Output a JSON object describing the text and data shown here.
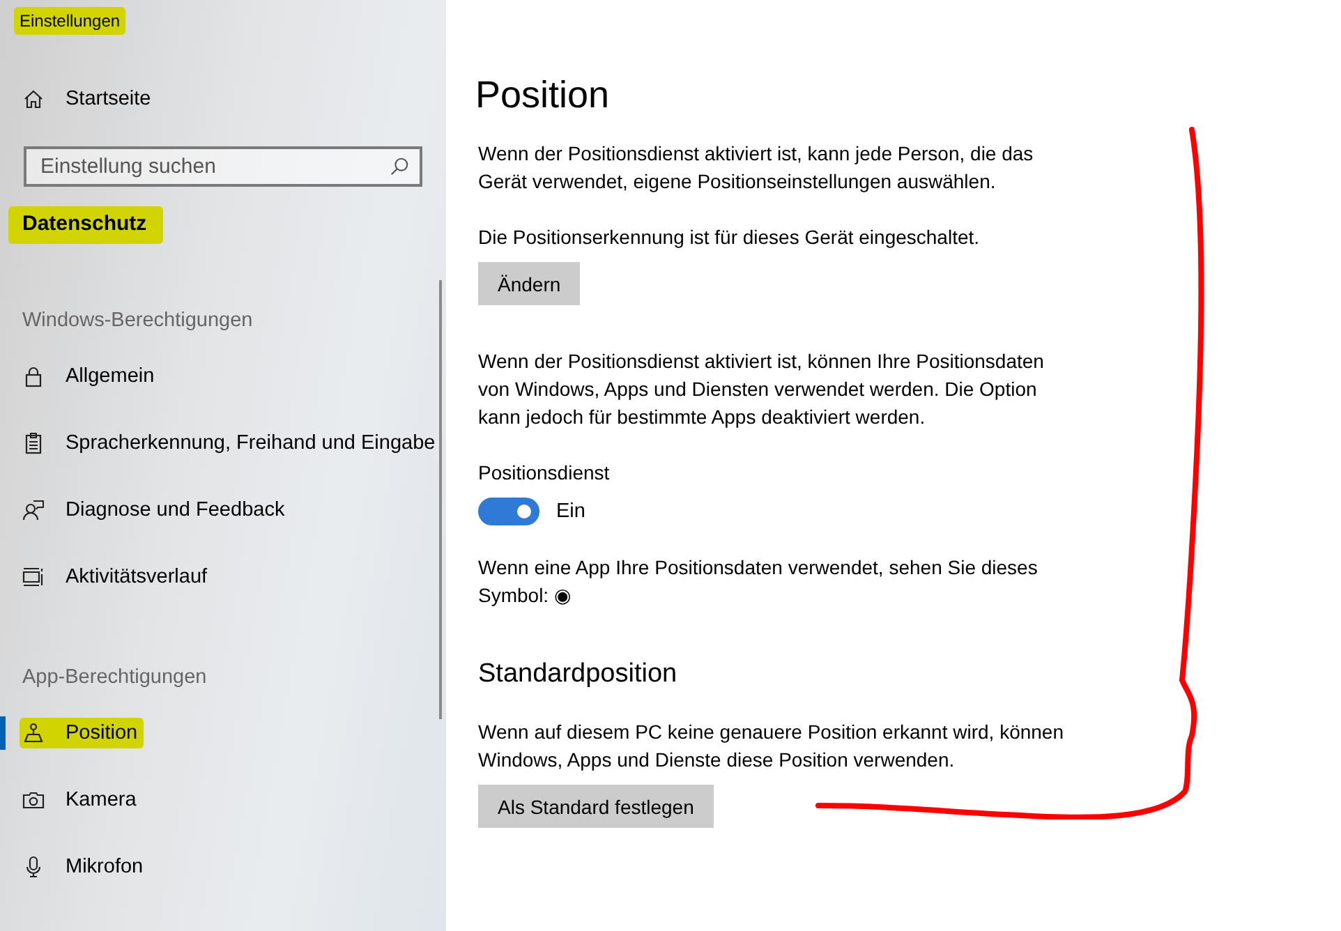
{
  "window": {
    "title": "Einstellungen",
    "highlighted": true
  },
  "sidebar": {
    "home": {
      "label": "Startseite"
    },
    "search": {
      "placeholder": "Einstellung suchen"
    },
    "category": {
      "label": "Datenschutz",
      "highlighted": true
    },
    "groups": [
      {
        "heading": "Windows-Berechtigungen",
        "items": [
          {
            "label": "Allgemein",
            "selected": false,
            "highlighted": false
          },
          {
            "label": "Spracherkennung, Freihand und Eingabe",
            "selected": false,
            "highlighted": false
          },
          {
            "label": "Diagnose und Feedback",
            "selected": false,
            "highlighted": false
          },
          {
            "label": "Aktivitätsverlauf",
            "selected": false,
            "highlighted": false
          }
        ]
      },
      {
        "heading": "App-Berechtigungen",
        "items": [
          {
            "label": "Position",
            "selected": true,
            "highlighted": true
          },
          {
            "label": "Kamera",
            "selected": false,
            "highlighted": false
          },
          {
            "label": "Mikrofon",
            "selected": false,
            "highlighted": false
          }
        ]
      }
    ]
  },
  "content": {
    "title": "Position",
    "blocks": [
      {
        "kind": "paragraph",
        "text": "Wenn der Positionsdienst aktiviert ist, kann jede Person, die das Gerät verwendet, eigene Positionseinstellungen auswählen."
      },
      {
        "kind": "paragraph",
        "text": "Die Positionserkennung ist für dieses Gerät eingeschaltet."
      },
      {
        "kind": "button",
        "text": "Ändern"
      },
      {
        "kind": "paragraph",
        "text": "Wenn der Positionsdienst aktiviert ist, können Ihre Positionsdaten von Windows, Apps und Diensten verwendet werden. Die Option kann jedoch für bestimmte Apps deaktiviert werden."
      },
      {
        "kind": "label",
        "text": "Positionsdienst"
      },
      {
        "kind": "toggle",
        "on": true,
        "text": "Ein"
      },
      {
        "kind": "symbol",
        "text": "Wenn eine App Ihre Positionsdaten verwendet, sehen Sie dieses Symbol: ◉"
      },
      {
        "kind": "heading",
        "text": "Standardposition"
      },
      {
        "kind": "paragraph",
        "text": "Wenn auf diesem PC keine genauere Position erkannt wird, können Windows, Apps und Dienste diese Position verwenden."
      },
      {
        "kind": "button",
        "text": "Als Standard festlegen"
      }
    ]
  }
}
